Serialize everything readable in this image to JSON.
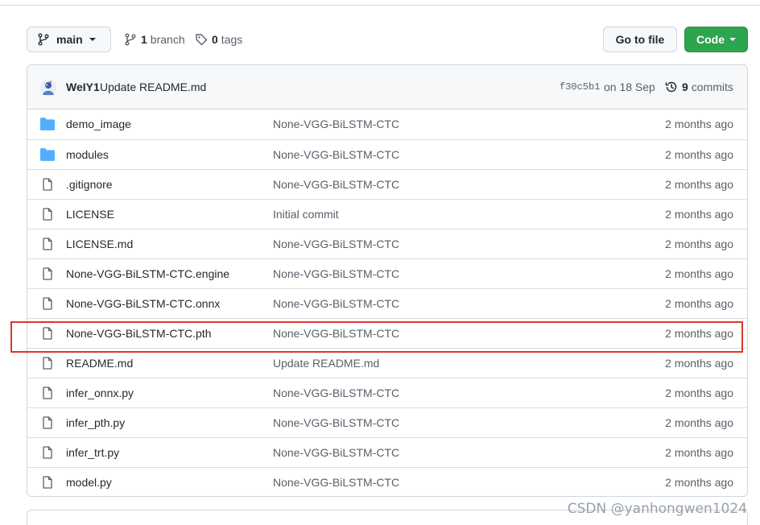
{
  "toolbar": {
    "branch_label": "main",
    "branches_count": "1",
    "branches_label": "branch",
    "tags_count": "0",
    "tags_label": "tags",
    "go_to_file_label": "Go to file",
    "code_label": "Code"
  },
  "latest_commit": {
    "author": "WeIY1",
    "message": "Update README.md",
    "sha": "f30c5b1",
    "date": "on 18 Sep",
    "commits_count": "9",
    "commits_label": "commits"
  },
  "files": [
    {
      "name": "demo_image",
      "type": "folder",
      "commit": "None-VGG-BiLSTM-CTC",
      "age": "2 months ago"
    },
    {
      "name": "modules",
      "type": "folder",
      "commit": "None-VGG-BiLSTM-CTC",
      "age": "2 months ago"
    },
    {
      "name": ".gitignore",
      "type": "file",
      "commit": "None-VGG-BiLSTM-CTC",
      "age": "2 months ago"
    },
    {
      "name": "LICENSE",
      "type": "file",
      "commit": "Initial commit",
      "age": "2 months ago"
    },
    {
      "name": "LICENSE.md",
      "type": "file",
      "commit": "None-VGG-BiLSTM-CTC",
      "age": "2 months ago"
    },
    {
      "name": "None-VGG-BiLSTM-CTC.engine",
      "type": "file",
      "commit": "None-VGG-BiLSTM-CTC",
      "age": "2 months ago"
    },
    {
      "name": "None-VGG-BiLSTM-CTC.onnx",
      "type": "file",
      "commit": "None-VGG-BiLSTM-CTC",
      "age": "2 months ago"
    },
    {
      "name": "None-VGG-BiLSTM-CTC.pth",
      "type": "file",
      "commit": "None-VGG-BiLSTM-CTC",
      "age": "2 months ago"
    },
    {
      "name": "README.md",
      "type": "file",
      "commit": "Update README.md",
      "age": "2 months ago"
    },
    {
      "name": "infer_onnx.py",
      "type": "file",
      "commit": "None-VGG-BiLSTM-CTC",
      "age": "2 months ago"
    },
    {
      "name": "infer_pth.py",
      "type": "file",
      "commit": "None-VGG-BiLSTM-CTC",
      "age": "2 months ago"
    },
    {
      "name": "infer_trt.py",
      "type": "file",
      "commit": "None-VGG-BiLSTM-CTC",
      "age": "2 months ago"
    },
    {
      "name": "model.py",
      "type": "file",
      "commit": "None-VGG-BiLSTM-CTC",
      "age": "2 months ago"
    }
  ],
  "watermark": "CSDN @yanhongwen1024",
  "colors": {
    "folder_icon": "#54aeff",
    "file_icon": "#57606a",
    "code_button": "#2da44e",
    "highlight_box": "#e0352b"
  },
  "icons": {
    "branch": "git-branch-icon",
    "tag": "tag-icon",
    "history": "history-icon",
    "folder": "folder-icon",
    "file": "file-icon"
  }
}
